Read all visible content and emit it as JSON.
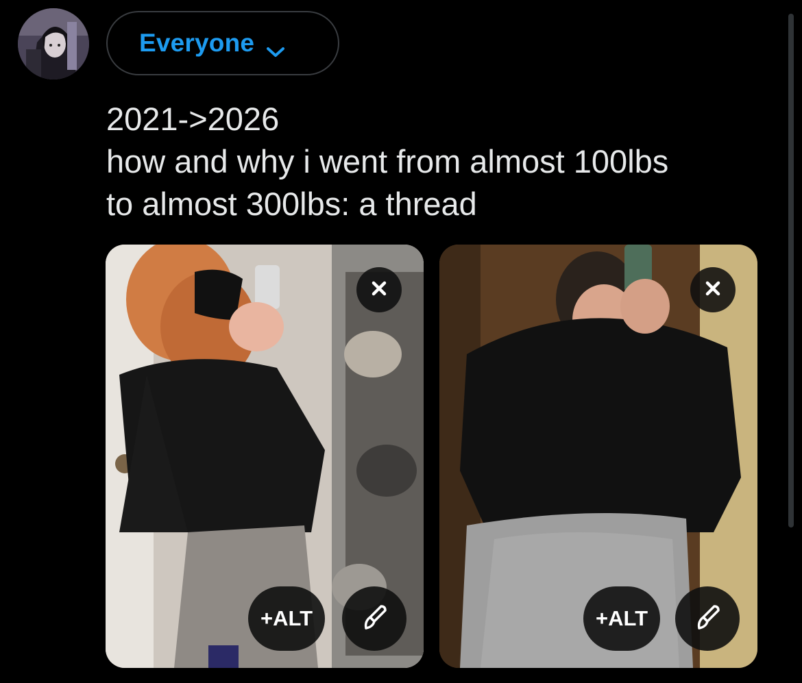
{
  "composer": {
    "audience_label": "Everyone",
    "text": "2021->2026\nhow and why i went from almost 100lbs\nto almost 300lbs: a thread"
  },
  "media": [
    {
      "alt_label": "+ALT",
      "remove_icon": "close-icon",
      "edit_icon": "brush-icon"
    },
    {
      "alt_label": "+ALT",
      "remove_icon": "close-icon",
      "edit_icon": "brush-icon"
    }
  ],
  "colors": {
    "background": "#000000",
    "accent": "#1d9bf0",
    "text": "#e7e9ea",
    "border": "#3a3d41"
  }
}
